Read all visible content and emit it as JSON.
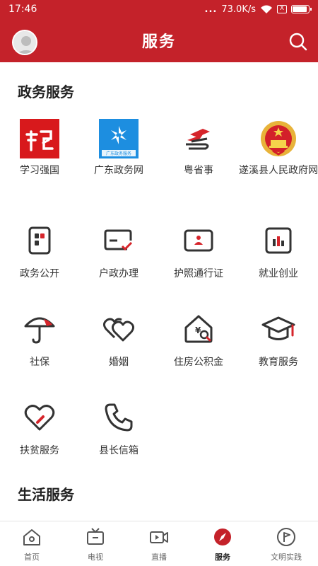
{
  "status_bar": {
    "time": "17:46",
    "dots": "...",
    "speed": "73.0K/s",
    "sim": "X"
  },
  "header": {
    "title": "服务",
    "search_icon": "search-icon",
    "avatar_icon": "avatar-icon"
  },
  "sections": [
    {
      "title": "政务服务"
    },
    {
      "title": "生活服务"
    }
  ],
  "gov_apps": [
    {
      "label": "学习强国",
      "icon": "xuexi-logo"
    },
    {
      "label": "广东政务网",
      "icon": "guangdong-gov-logo",
      "logo_caption": "广东政务服务"
    },
    {
      "label": "粤省事",
      "icon": "yueshengshi-logo"
    },
    {
      "label": "遂溪县人民政府网",
      "icon": "national-emblem"
    }
  ],
  "services": [
    {
      "label": "政务公开",
      "icon": "gov-disclosure-icon"
    },
    {
      "label": "户政办理",
      "icon": "household-icon"
    },
    {
      "label": "护照通行证",
      "icon": "passport-icon"
    },
    {
      "label": "就业创业",
      "icon": "employment-icon"
    },
    {
      "label": "社保",
      "icon": "umbrella-icon"
    },
    {
      "label": "婚姻",
      "icon": "hearts-icon"
    },
    {
      "label": "住房公积金",
      "icon": "housing-fund-icon"
    },
    {
      "label": "教育服务",
      "icon": "graduation-cap-icon"
    },
    {
      "label": "扶贫服务",
      "icon": "heart-icon"
    },
    {
      "label": "县长信箱",
      "icon": "phone-icon"
    }
  ],
  "tabs": [
    {
      "label": "首页",
      "icon": "home-icon",
      "active": false
    },
    {
      "label": "电视",
      "icon": "tv-icon",
      "active": false
    },
    {
      "label": "直播",
      "icon": "live-video-icon",
      "active": false
    },
    {
      "label": "服务",
      "icon": "compass-icon",
      "active": true
    },
    {
      "label": "文明实践",
      "icon": "flag-icon",
      "active": false
    }
  ],
  "colors": {
    "brand_red": "#c4222a",
    "icon_dark": "#333333",
    "tab_active": "#c4222a"
  }
}
